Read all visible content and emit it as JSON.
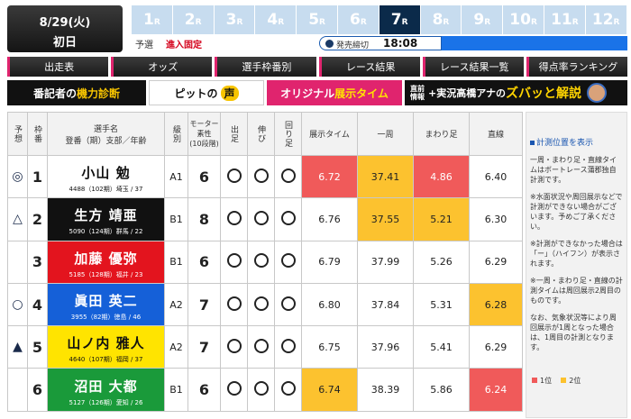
{
  "header": {
    "date": "8/29(火)",
    "day": "初日",
    "races": [
      {
        "num": "1",
        "suffix": "R",
        "active": false
      },
      {
        "num": "2",
        "suffix": "R",
        "active": false
      },
      {
        "num": "3",
        "suffix": "R",
        "active": false
      },
      {
        "num": "4",
        "suffix": "R",
        "active": false
      },
      {
        "num": "5",
        "suffix": "R",
        "active": false
      },
      {
        "num": "6",
        "suffix": "R",
        "active": false
      },
      {
        "num": "7",
        "suffix": "R",
        "active": true
      },
      {
        "num": "8",
        "suffix": "R",
        "active": false
      },
      {
        "num": "9",
        "suffix": "R",
        "active": false
      },
      {
        "num": "10",
        "suffix": "R",
        "active": false
      },
      {
        "num": "11",
        "suffix": "R",
        "active": false
      },
      {
        "num": "12",
        "suffix": "R",
        "active": false
      }
    ],
    "status": {
      "yosen": "予選",
      "fixed": "進入固定",
      "deadline_label": "発売締切",
      "deadline_time": "18:08"
    }
  },
  "menu": [
    "出走表",
    "オッズ",
    "選手枠番別",
    "レース結果",
    "レース結果一覧",
    "得点率ランキング"
  ],
  "features": {
    "kiryoku_pre": "番記者の",
    "kiryoku_hl": "機力診断",
    "pit_pre": "ピットの",
    "pit_hl": "声",
    "tenji_pre": "オリジナル",
    "tenji_hl": "展示タイム",
    "jikkyo_small": "直前\n情報",
    "jikkyo_mid": "+実況高橋アナの",
    "jikkyo_hl": "ズバッと解説"
  },
  "table": {
    "headers": {
      "yoso": "予想",
      "waku": "枠番",
      "player": "選手名\n登番（期）支部／年齢",
      "grade": "級別",
      "motor": "モーター素性\n(10段階)",
      "de": "出足",
      "nobi": "伸び",
      "mawari": "回り足",
      "tenji": "展示タイム",
      "isshu": "一周",
      "mawariashi": "まわり足",
      "chokusen": "直線"
    },
    "rows": [
      {
        "yoso": "◎",
        "waku": "1",
        "name": "小山 勉",
        "info": "4488（102期）埼玉 / 37",
        "grade": "A1",
        "motor": "6",
        "tenji": "6.72",
        "isshu": "37.41",
        "mawari": "4.86",
        "chokusen": "6.40",
        "bg": "#ffffff",
        "fg": "#111111",
        "tenji_rank": 1,
        "isshu_rank": 2,
        "mawari_rank": 1,
        "chokusen_rank": 0
      },
      {
        "yoso": "△",
        "waku": "2",
        "name": "生方 靖亜",
        "info": "5090（124期）群馬 / 22",
        "grade": "B1",
        "motor": "8",
        "tenji": "6.76",
        "isshu": "37.55",
        "mawari": "5.21",
        "chokusen": "6.30",
        "bg": "#111111",
        "fg": "#ffffff",
        "tenji_rank": 0,
        "isshu_rank": 2,
        "mawari_rank": 2,
        "chokusen_rank": 0
      },
      {
        "yoso": "",
        "waku": "3",
        "name": "加藤 優弥",
        "info": "5185（128期）福井 / 23",
        "grade": "B1",
        "motor": "6",
        "tenji": "6.79",
        "isshu": "37.99",
        "mawari": "5.26",
        "chokusen": "6.29",
        "bg": "#e3141e",
        "fg": "#ffffff",
        "tenji_rank": 0,
        "isshu_rank": 0,
        "mawari_rank": 0,
        "chokusen_rank": 0
      },
      {
        "yoso": "○",
        "waku": "4",
        "name": "眞田 英二",
        "info": "3955（82期）徳島 / 46",
        "grade": "A2",
        "motor": "7",
        "tenji": "6.80",
        "isshu": "37.84",
        "mawari": "5.31",
        "chokusen": "6.28",
        "bg": "#1560d8",
        "fg": "#ffffff",
        "tenji_rank": 0,
        "isshu_rank": 0,
        "mawari_rank": 0,
        "chokusen_rank": 2
      },
      {
        "yoso": "▲",
        "waku": "5",
        "name": "山ノ内 雅人",
        "info": "4640（107期）福岡 / 37",
        "grade": "A2",
        "motor": "7",
        "tenji": "6.75",
        "isshu": "37.96",
        "mawari": "5.41",
        "chokusen": "6.29",
        "bg": "#ffe400",
        "fg": "#111111",
        "tenji_rank": 0,
        "isshu_rank": 0,
        "mawari_rank": 0,
        "chokusen_rank": 0
      },
      {
        "yoso": "",
        "waku": "6",
        "name": "沼田 大都",
        "info": "5127（126期）愛知 / 26",
        "grade": "B1",
        "motor": "6",
        "tenji": "6.74",
        "isshu": "38.39",
        "mawari": "5.86",
        "chokusen": "6.24",
        "bg": "#1a9a3a",
        "fg": "#ffffff",
        "tenji_rank": 2,
        "isshu_rank": 0,
        "mawari_rank": 0,
        "chokusen_rank": 1
      }
    ]
  },
  "side": {
    "link": "計測位置を表示",
    "note1": "一周・まわり足・直線タイムはボートレース蒲郡独自計測です。",
    "note2": "※水面状況や周回展示などで計測ができない場合がございます。予めご了承ください。",
    "note3": "※計測ができなかった場合は「ー」（ハイフン）が表示されます。",
    "note4": "※一周・まわり足・直線の計測タイムは周回展示2周目のものです。",
    "note5": "なお、気象状況等により周回展示が1周となった場合は、1周目の計測となります。",
    "legend1": "1位",
    "legend2": "2位"
  },
  "colors": {
    "rank1": "#f05a5a",
    "rank2": "#fcc22f",
    "active_tab": "#0b2a4a",
    "inactive_tab": "#c7dcef",
    "accent_pink": "#e0246e"
  }
}
